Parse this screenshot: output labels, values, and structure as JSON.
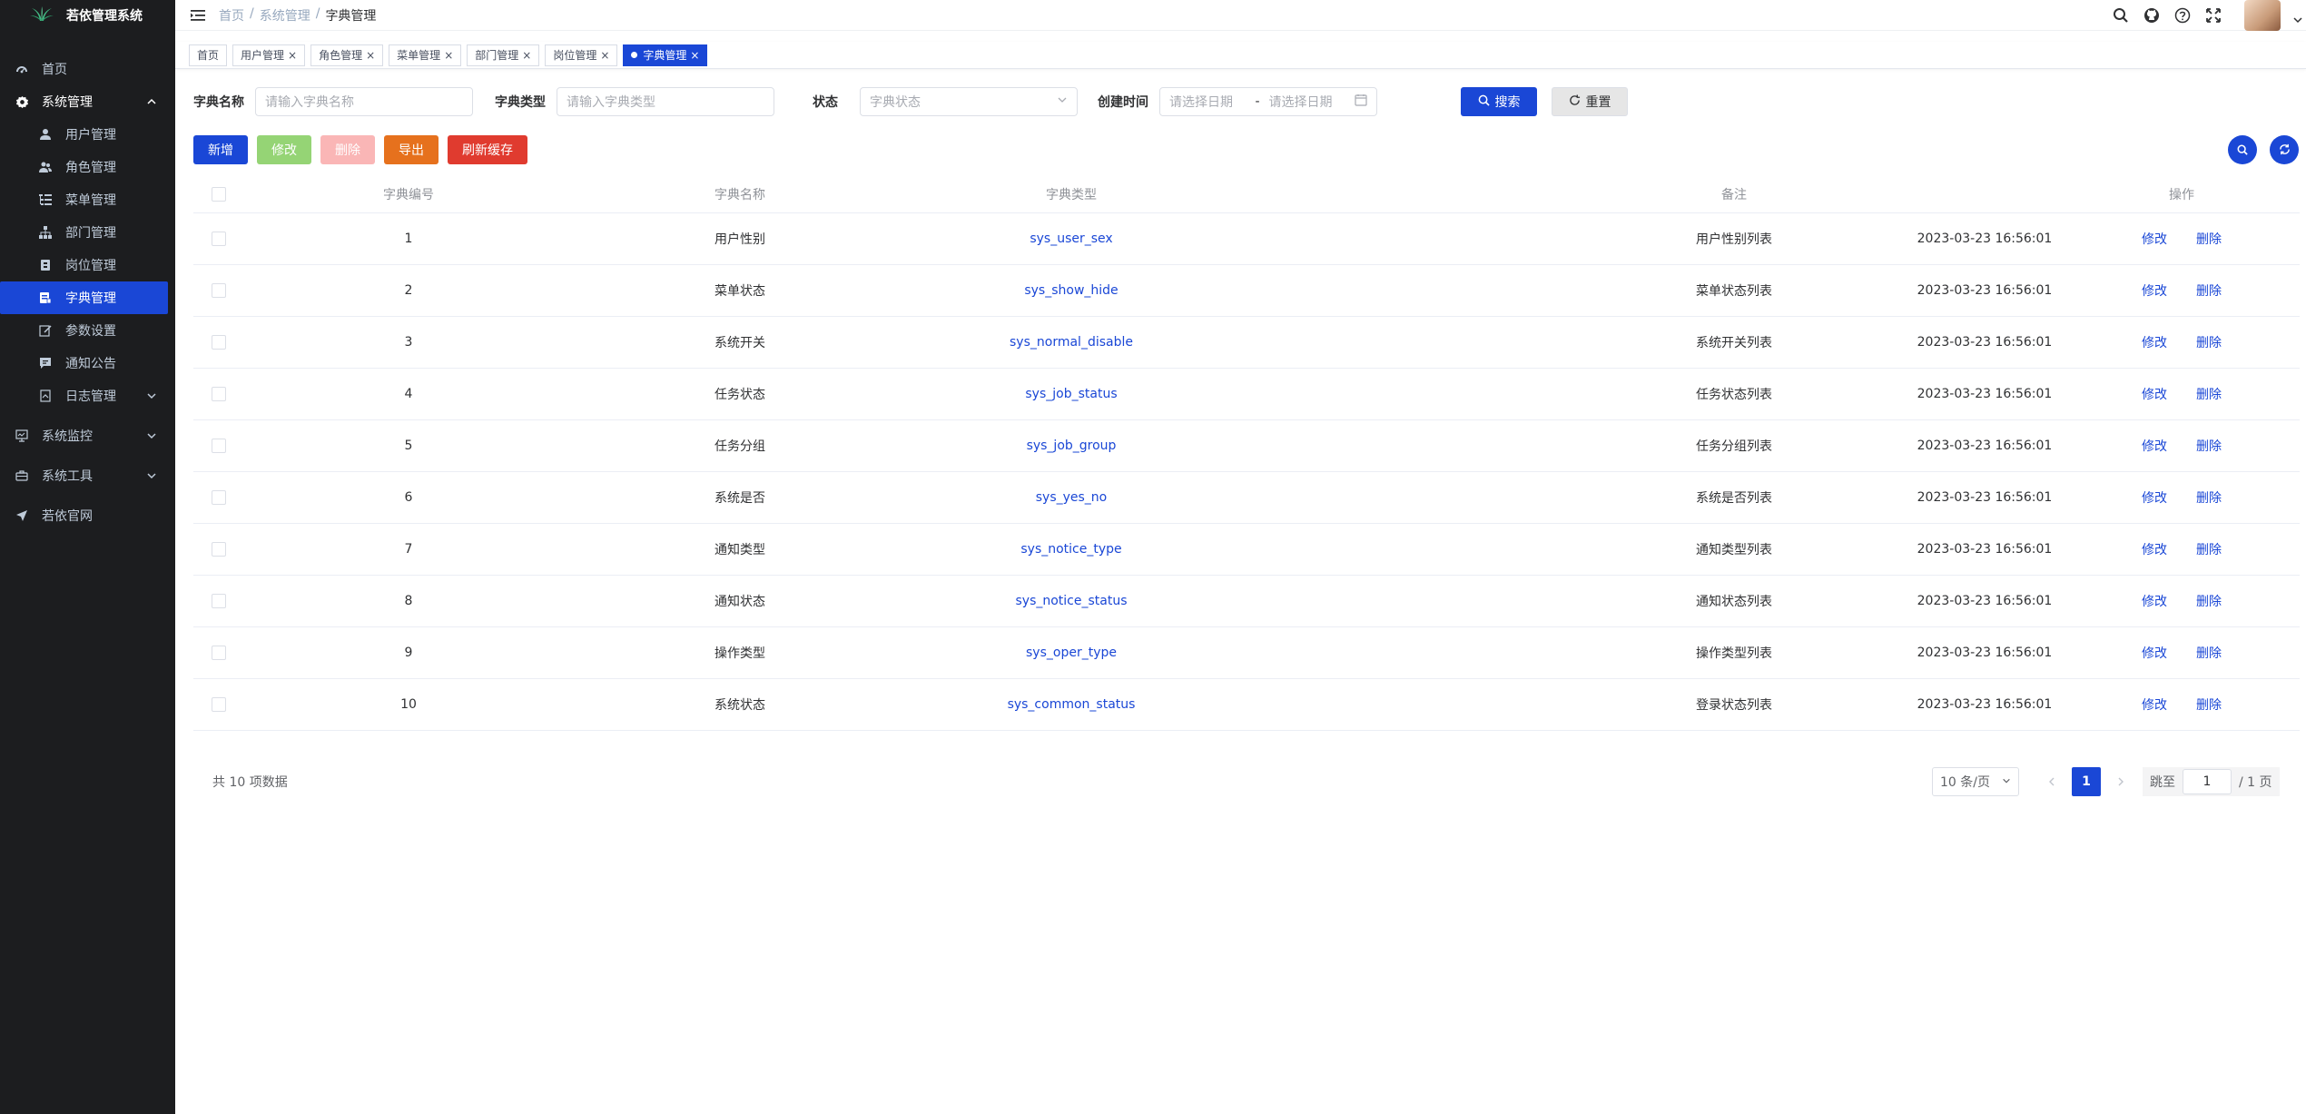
{
  "app": {
    "title": "若依管理系统"
  },
  "sidebar": {
    "items": [
      {
        "label": "首页",
        "icon": "dashboard-icon"
      },
      {
        "label": "系统管理",
        "icon": "gear-icon"
      },
      {
        "label": "用户管理",
        "icon": "user-icon"
      },
      {
        "label": "角色管理",
        "icon": "peoples-icon"
      },
      {
        "label": "菜单管理",
        "icon": "tree-table-icon"
      },
      {
        "label": "部门管理",
        "icon": "tree-icon"
      },
      {
        "label": "岗位管理",
        "icon": "post-icon"
      },
      {
        "label": "字典管理",
        "icon": "dict-icon"
      },
      {
        "label": "参数设置",
        "icon": "edit-icon"
      },
      {
        "label": "通知公告",
        "icon": "message-icon"
      },
      {
        "label": "日志管理",
        "icon": "log-icon"
      },
      {
        "label": "系统监控",
        "icon": "monitor-icon"
      },
      {
        "label": "系统工具",
        "icon": "tool-icon"
      },
      {
        "label": "若依官网",
        "icon": "guide-icon"
      }
    ]
  },
  "breadcrumb": {
    "home": "首页",
    "parent": "系统管理",
    "current": "字典管理",
    "sep": "/"
  },
  "tags": [
    {
      "label": "首页"
    },
    {
      "label": "用户管理"
    },
    {
      "label": "角色管理"
    },
    {
      "label": "菜单管理"
    },
    {
      "label": "部门管理"
    },
    {
      "label": "岗位管理"
    },
    {
      "label": "字典管理"
    }
  ],
  "tag_close": "×",
  "form": {
    "dict_name_label": "字典名称",
    "dict_name_placeholder": "请输入字典名称",
    "dict_type_label": "字典类型",
    "dict_type_placeholder": "请输入字典类型",
    "status_label": "状态",
    "status_placeholder": "字典状态",
    "created_label": "创建时间",
    "start_placeholder": "请选择日期",
    "range_sep": "-",
    "end_placeholder": "请选择日期",
    "search_btn": "搜索",
    "reset_btn": "重置"
  },
  "toolbar": {
    "add": "新增",
    "edit": "修改",
    "delete": "删除",
    "export": "导出",
    "refresh_cache": "刷新缓存"
  },
  "table": {
    "headers": {
      "id": "字典编号",
      "name": "字典名称",
      "type": "字典类型",
      "remark": "备注",
      "time": "创建时间",
      "ops": "操作"
    },
    "op_edit": "修改",
    "op_delete": "删除",
    "rows": [
      {
        "id": "1",
        "name": "用户性别",
        "type": "sys_user_sex",
        "remark": "用户性别列表",
        "time": "2023-03-23 16:56:01"
      },
      {
        "id": "2",
        "name": "菜单状态",
        "type": "sys_show_hide",
        "remark": "菜单状态列表",
        "time": "2023-03-23 16:56:01"
      },
      {
        "id": "3",
        "name": "系统开关",
        "type": "sys_normal_disable",
        "remark": "系统开关列表",
        "time": "2023-03-23 16:56:01"
      },
      {
        "id": "4",
        "name": "任务状态",
        "type": "sys_job_status",
        "remark": "任务状态列表",
        "time": "2023-03-23 16:56:01"
      },
      {
        "id": "5",
        "name": "任务分组",
        "type": "sys_job_group",
        "remark": "任务分组列表",
        "time": "2023-03-23 16:56:01"
      },
      {
        "id": "6",
        "name": "系统是否",
        "type": "sys_yes_no",
        "remark": "系统是否列表",
        "time": "2023-03-23 16:56:01"
      },
      {
        "id": "7",
        "name": "通知类型",
        "type": "sys_notice_type",
        "remark": "通知类型列表",
        "time": "2023-03-23 16:56:01"
      },
      {
        "id": "8",
        "name": "通知状态",
        "type": "sys_notice_status",
        "remark": "通知状态列表",
        "time": "2023-03-23 16:56:01"
      },
      {
        "id": "9",
        "name": "操作类型",
        "type": "sys_oper_type",
        "remark": "操作类型列表",
        "time": "2023-03-23 16:56:01"
      },
      {
        "id": "10",
        "name": "系统状态",
        "type": "sys_common_status",
        "remark": "登录状态列表",
        "time": "2023-03-23 16:56:01"
      }
    ]
  },
  "pagination": {
    "total": "共 10 项数据",
    "page_size": "10 条/页",
    "current": "1",
    "jump_label": "跳至",
    "jump_value": "1",
    "total_pages": "/ 1 页"
  },
  "colors": {
    "primary": "#1a47d6",
    "sidebar_bg": "#1c1d1f",
    "success": "#95d475",
    "danger_light": "#fab6b6",
    "warning": "#e6711d",
    "danger": "#e03b2f"
  }
}
